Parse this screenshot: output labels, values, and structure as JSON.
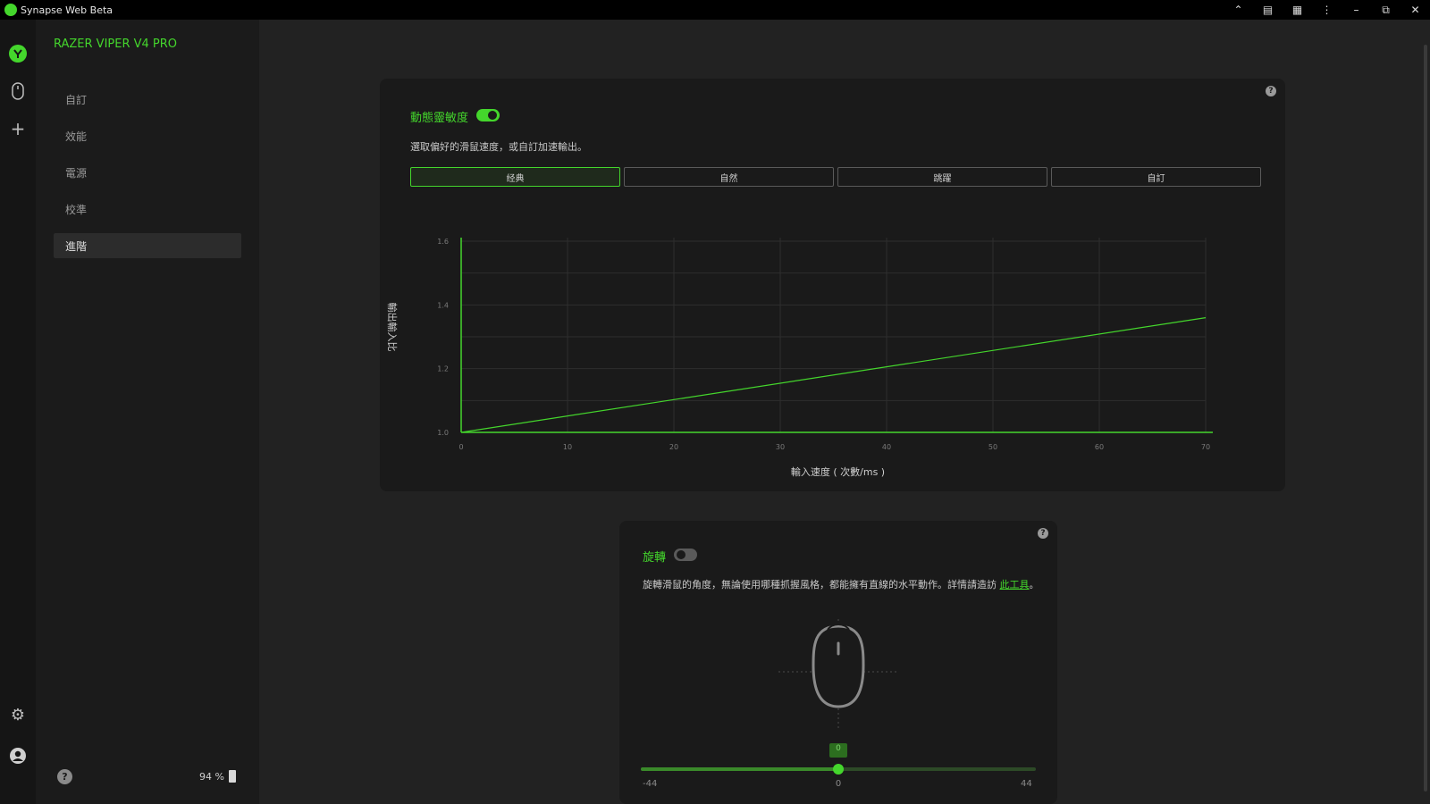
{
  "window": {
    "title": "Synapse Web Beta"
  },
  "sidebar": {
    "device_name": "RAZER VIPER V4 PRO",
    "items": [
      {
        "label": "自訂",
        "active": false
      },
      {
        "label": "效能",
        "active": false
      },
      {
        "label": "電源",
        "active": false
      },
      {
        "label": "校準",
        "active": false
      },
      {
        "label": "進階",
        "active": true
      }
    ],
    "battery": "94 %"
  },
  "sensitivity": {
    "title": "動態靈敏度",
    "enabled": true,
    "description": "選取偏好的滑鼠速度，或自訂加速輸出。",
    "presets": [
      {
        "label": "经典",
        "active": true
      },
      {
        "label": "自然",
        "active": false
      },
      {
        "label": "跳躍",
        "active": false
      },
      {
        "label": "自訂",
        "active": false
      }
    ]
  },
  "rotation": {
    "title": "旋轉",
    "enabled": false,
    "description": "旋轉滑鼠的角度，無論使用哪種抓握風格，都能擁有直線的水平動作。詳情請造訪",
    "link": "此工具",
    "suffix": "。",
    "slider": {
      "value": "0",
      "min_label": "-44",
      "mid_label": "0",
      "max_label": "44"
    }
  },
  "colors": {
    "accent": "#44d62c",
    "bg": "#222222",
    "card": "#1a1a1a"
  },
  "chart_data": {
    "type": "line",
    "title": "",
    "xlabel": "輸入速度 ( 次數/ms )",
    "ylabel": "輸出輸入比",
    "xlim": [
      0,
      70
    ],
    "ylim": [
      1.0,
      1.6
    ],
    "xticks": [
      "0",
      "10",
      "20",
      "30",
      "40",
      "50",
      "60",
      "70"
    ],
    "yticks": [
      "1.0",
      "1.2",
      "1.4",
      "1.6"
    ],
    "grid": true,
    "series": [
      {
        "x": [
          0,
          70
        ],
        "y": [
          1.0,
          1.36
        ]
      }
    ]
  }
}
